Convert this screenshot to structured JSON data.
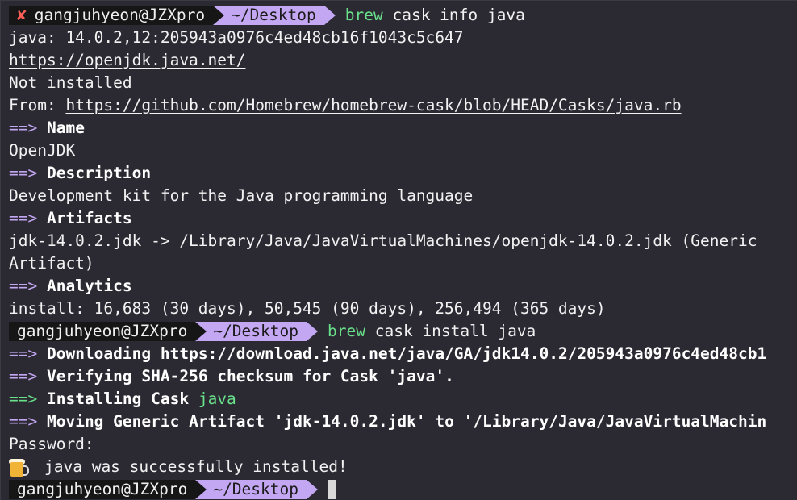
{
  "prompt": {
    "error_mark": "✘",
    "user_host": "gangjuhyeon@JZXpro",
    "path": "~/Desktop"
  },
  "commands": {
    "cmd1_bin": "brew",
    "cmd1_args": "cask info java",
    "cmd2_bin": "brew",
    "cmd2_args": "cask install java"
  },
  "info": {
    "version_line": "java: 14.0.2,12:205943a0976c4ed48cb16f1043c5c647",
    "homepage": "https://openjdk.java.net/",
    "status": "Not installed",
    "from_label": "From: ",
    "from_url": "https://github.com/Homebrew/homebrew-cask/blob/HEAD/Casks/java.rb",
    "arrow": "==>",
    "name_header": "Name",
    "name_value": "OpenJDK",
    "desc_header": "Description",
    "desc_value": "Development kit for the Java programming language",
    "artifacts_header": "Artifacts",
    "artifacts_line1": "jdk-14.0.2.jdk -> /Library/Java/JavaVirtualMachines/openjdk-14.0.2.jdk (Generic",
    "artifacts_line2": "Artifact)",
    "analytics_header": "Analytics",
    "analytics_value": "install: 16,683 (30 days), 50,545 (90 days), 256,494 (365 days)"
  },
  "install": {
    "downloading": "Downloading https://download.java.net/java/GA/jdk14.0.2/205943a0976c4ed48cb1",
    "verifying": "Verifying SHA-256 checksum for Cask 'java'.",
    "installing_prefix": "Installing Cask ",
    "installing_name": "java",
    "moving": "Moving Generic Artifact 'jdk-14.0.2.jdk' to '/Library/Java/JavaVirtualMachin",
    "password": "Password:",
    "success": "java was successfully installed!"
  }
}
